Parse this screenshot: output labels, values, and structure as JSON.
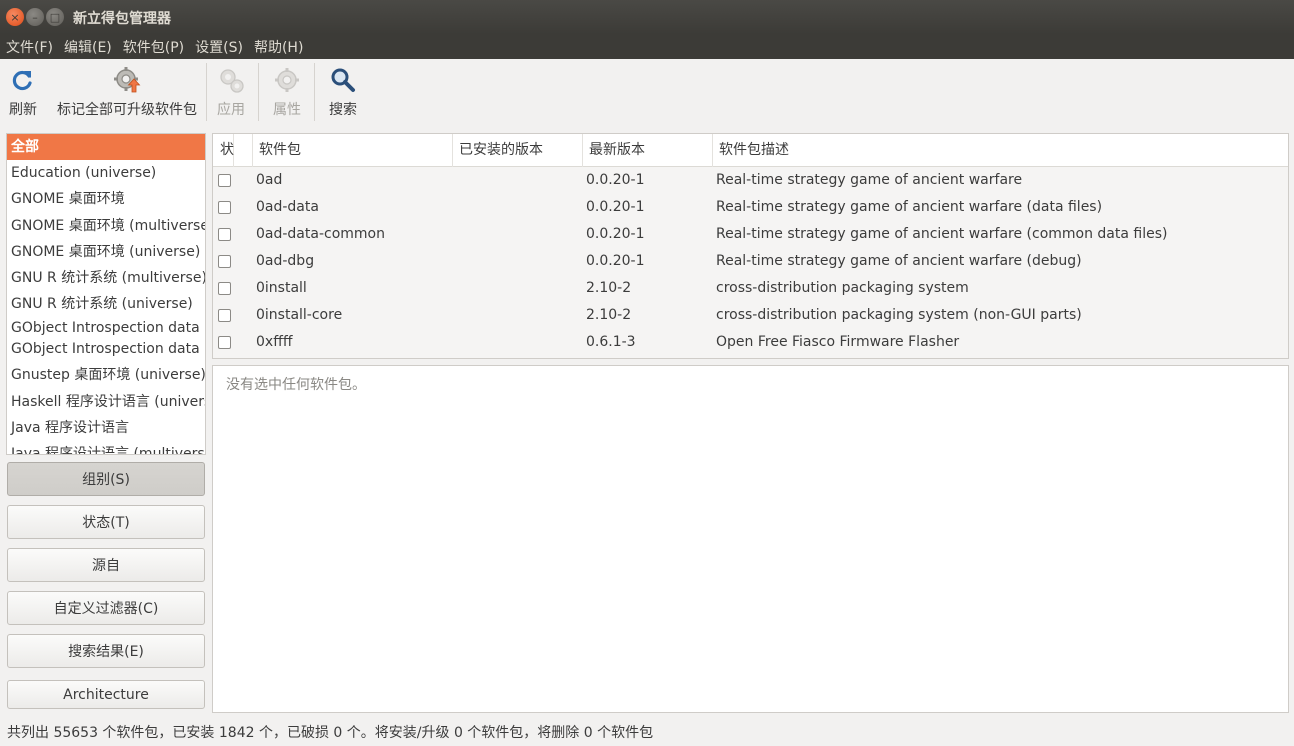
{
  "window": {
    "title": "新立得包管理器",
    "close_glyph": "×",
    "minimize_glyph": "–",
    "maximize_glyph": "□"
  },
  "menu": [
    "文件(F)",
    "编辑(E)",
    "软件包(P)",
    "设置(S)",
    "帮助(H)"
  ],
  "toolbar": {
    "refresh": {
      "label": "刷新",
      "icon": "refresh-icon"
    },
    "mark_upgrades": {
      "label": "标记全部可升级软件包",
      "icon": "mark-upgrades-icon"
    },
    "apply": {
      "label": "应用",
      "icon": "apply-icon",
      "disabled": true
    },
    "properties": {
      "label": "属性",
      "icon": "properties-icon",
      "disabled": true
    },
    "search": {
      "label": "搜索",
      "icon": "search-icon"
    }
  },
  "groups": [
    "全部",
    "Education (universe)",
    "GNOME 桌面环境",
    "GNOME 桌面环境 (multiverse)",
    "GNOME 桌面环境 (universe)",
    "GNU R 统计系统 (multiverse)",
    "GNU R 统计系统 (universe)",
    "GObject Introspection data",
    "GObject Introspection data (",
    "Gnustep 桌面环境 (universe)",
    "Haskell 程序设计语言 (universe)",
    "Java 程序设计语言",
    "Java 程序设计语言 (multiverse)"
  ],
  "selected_group": "全部",
  "filter_buttons": {
    "sections": "组别(S)",
    "status": "状态(T)",
    "origin": "源自",
    "custom": "自定义过滤器(C)",
    "search_results": "搜索结果(E)",
    "architecture": "Architecture"
  },
  "table": {
    "headers": {
      "status": "状",
      "package": "软件包",
      "installed_version": "已安装的版本",
      "latest_version": "最新版本",
      "description": "软件包描述"
    },
    "rows": [
      {
        "package": "0ad",
        "installed": "",
        "latest": "0.0.20-1",
        "description": "Real-time strategy game of ancient warfare"
      },
      {
        "package": "0ad-data",
        "installed": "",
        "latest": "0.0.20-1",
        "description": "Real-time strategy game of ancient warfare (data files)"
      },
      {
        "package": "0ad-data-common",
        "installed": "",
        "latest": "0.0.20-1",
        "description": "Real-time strategy game of ancient warfare (common data files)"
      },
      {
        "package": "0ad-dbg",
        "installed": "",
        "latest": "0.0.20-1",
        "description": "Real-time strategy game of ancient warfare (debug)"
      },
      {
        "package": "0install",
        "installed": "",
        "latest": "2.10-2",
        "description": "cross-distribution packaging system"
      },
      {
        "package": "0install-core",
        "installed": "",
        "latest": "2.10-2",
        "description": "cross-distribution packaging system (non-GUI parts)"
      },
      {
        "package": "0xffff",
        "installed": "",
        "latest": "0.6.1-3",
        "description": "Open Free Fiasco Firmware Flasher"
      }
    ]
  },
  "details": {
    "message": "没有选中任何软件包。"
  },
  "status_bar": "共列出 55653 个软件包，已安装 1842 个，已破损 0 个。将安装/升级 0 个软件包，将删除 0 个软件包",
  "colors": {
    "selection": "#f07746",
    "titlebar": "#3c3b37"
  }
}
